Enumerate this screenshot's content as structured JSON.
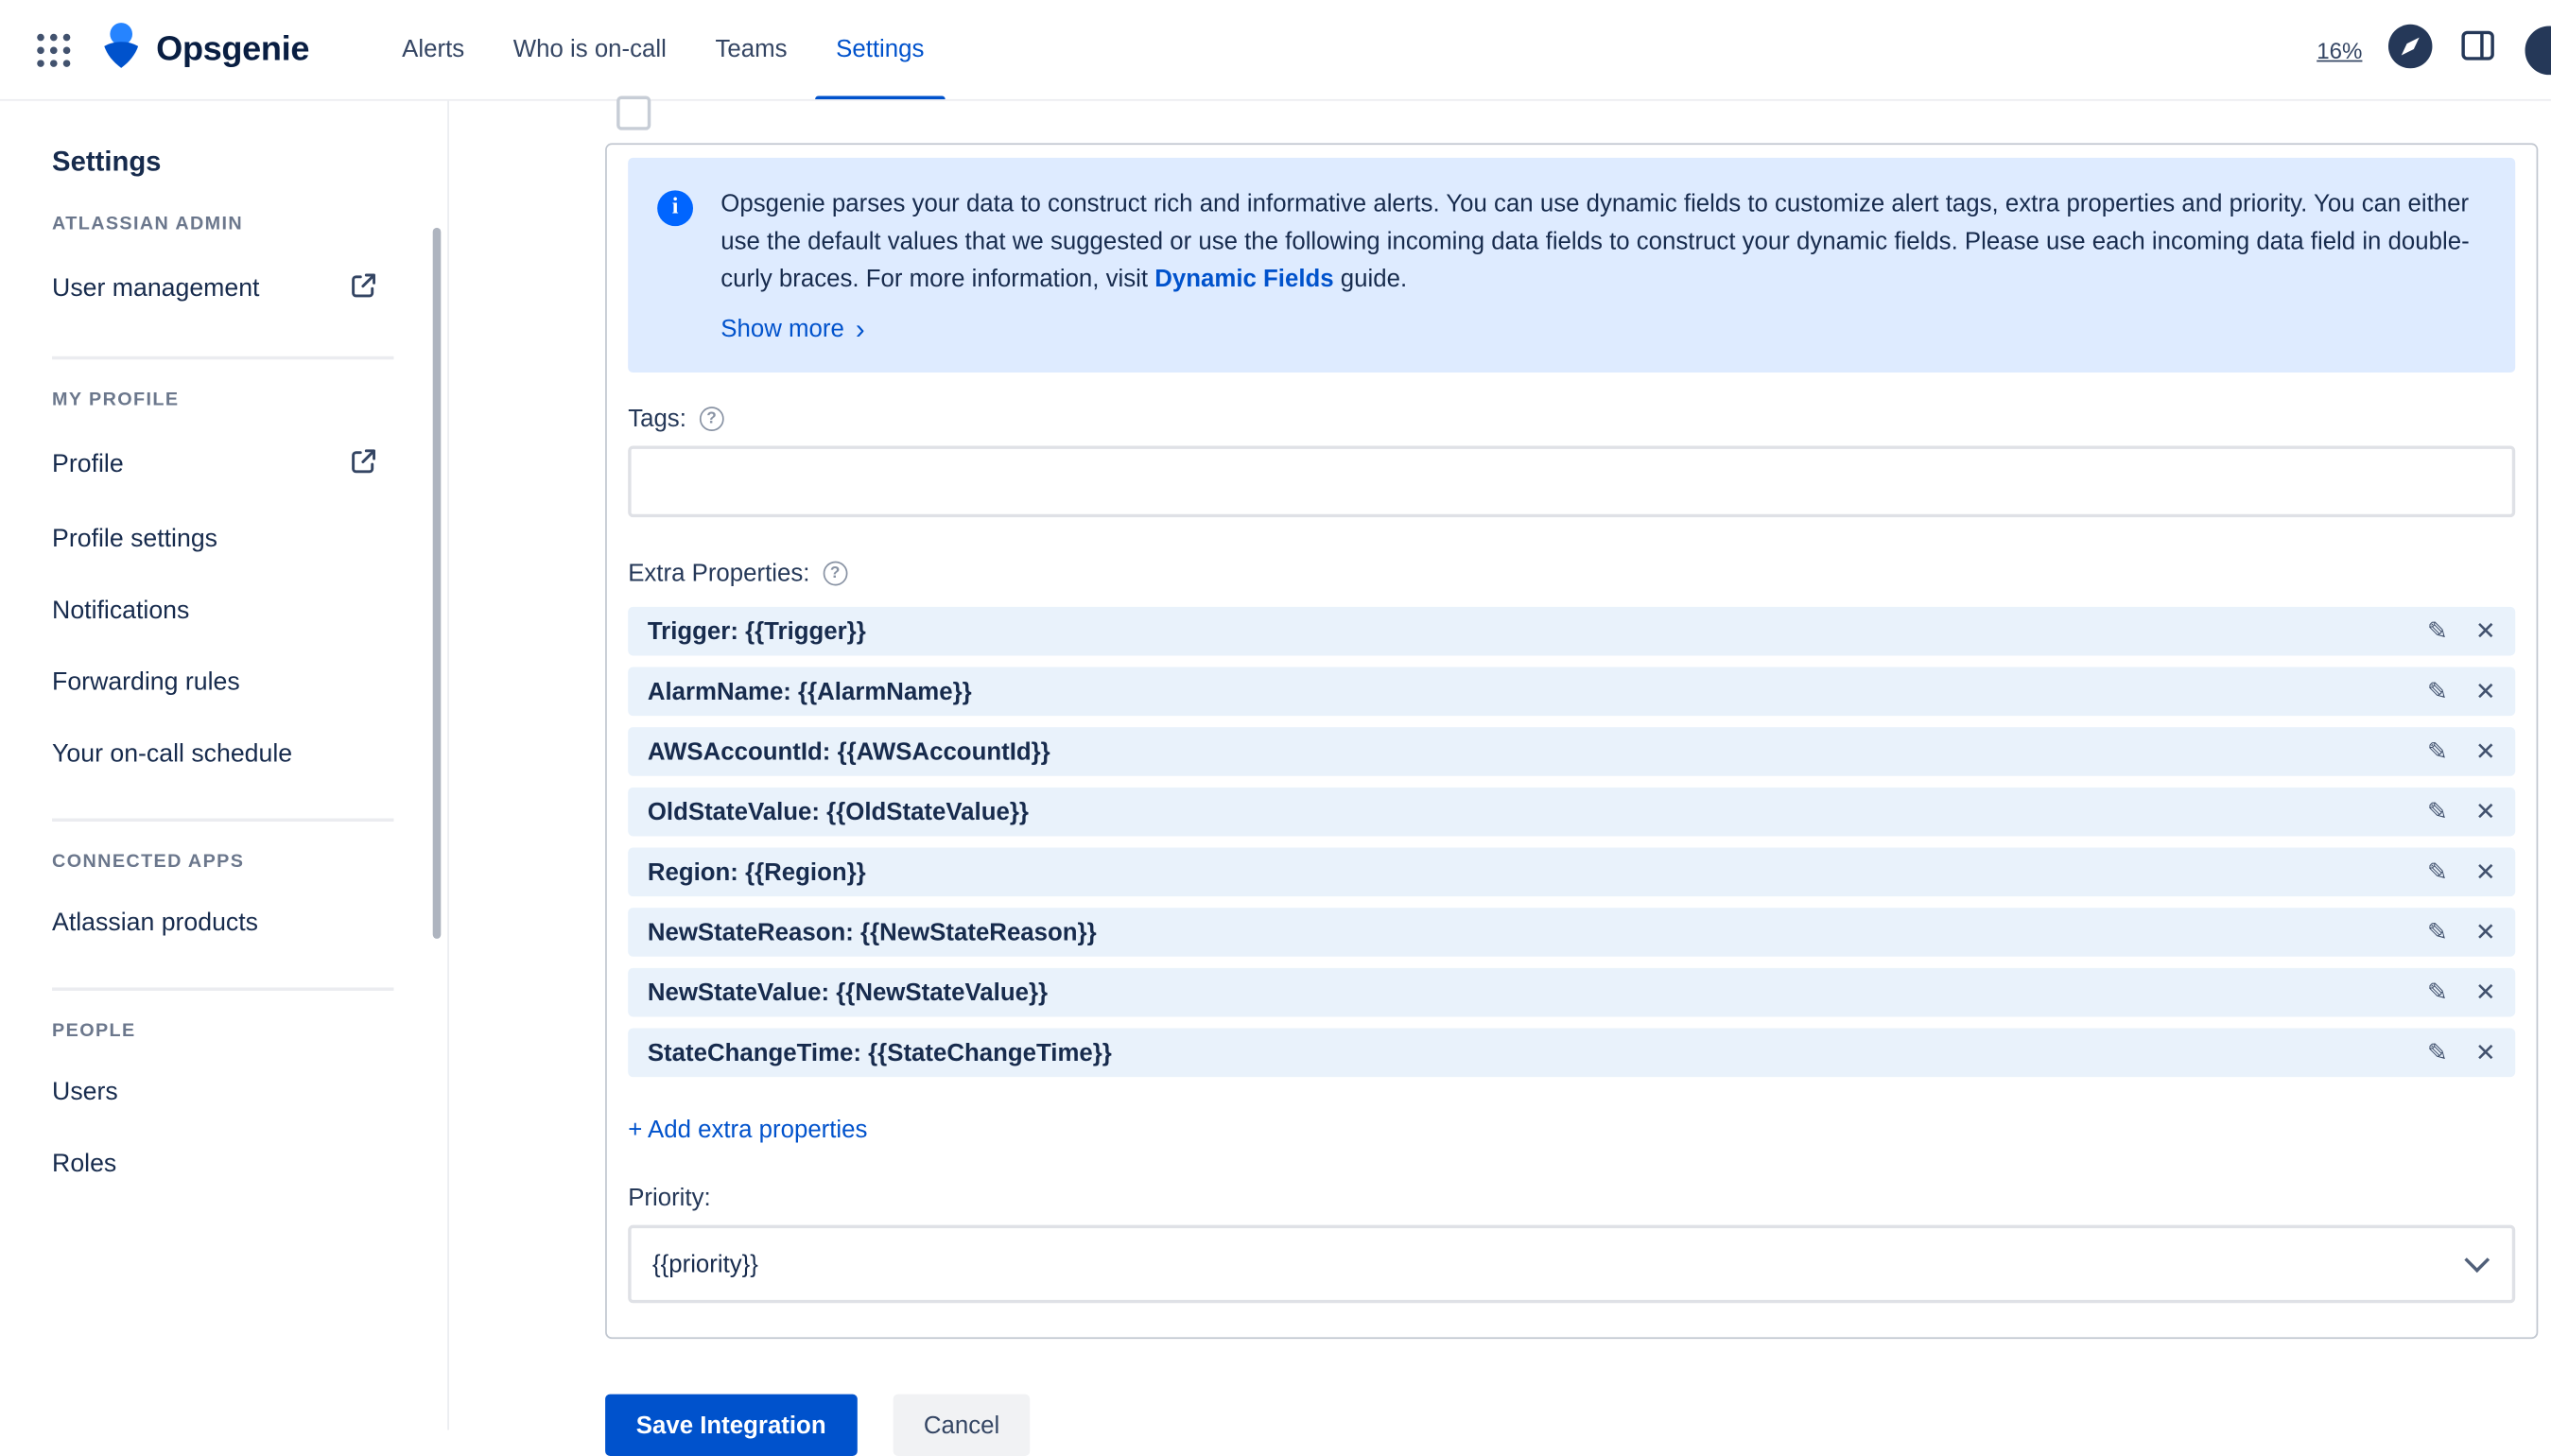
{
  "nav": {
    "brand": "Opsgenie",
    "items": [
      {
        "label": "Alerts",
        "active": false
      },
      {
        "label": "Who is on-call",
        "active": false
      },
      {
        "label": "Teams",
        "active": false
      },
      {
        "label": "Settings",
        "active": true
      }
    ],
    "usage": "16%"
  },
  "sidebar": {
    "title": "Settings",
    "sections": [
      {
        "heading": "ATLASSIAN ADMIN",
        "items": [
          {
            "label": "User management",
            "external": true
          }
        ]
      },
      {
        "heading": "MY PROFILE",
        "items": [
          {
            "label": "Profile",
            "external": true
          },
          {
            "label": "Profile settings",
            "external": false
          },
          {
            "label": "Notifications",
            "external": false
          },
          {
            "label": "Forwarding rules",
            "external": false
          },
          {
            "label": "Your on-call schedule",
            "external": false
          }
        ]
      },
      {
        "heading": "CONNECTED APPS",
        "items": [
          {
            "label": "Atlassian products",
            "external": false
          }
        ]
      },
      {
        "heading": "PEOPLE",
        "items": [
          {
            "label": "Users",
            "external": false
          },
          {
            "label": "Roles",
            "external": false
          }
        ]
      }
    ]
  },
  "main": {
    "info": {
      "text": "Opsgenie parses your data to construct rich and informative alerts. You can use dynamic fields to customize alert tags, extra properties and priority. You can either use the default values that we suggested or use the following incoming data fields to construct your dynamic fields. Please use each incoming data field in double-curly braces. For more information, visit ",
      "link_text": "Dynamic Fields",
      "after_link": " guide.",
      "show_more": "Show more"
    },
    "tags": {
      "label": "Tags:",
      "value": "",
      "placeholder": ""
    },
    "extra_properties": {
      "label": "Extra Properties:",
      "rows": [
        "Trigger: {{Trigger}}",
        "AlarmName: {{AlarmName}}",
        "AWSAccountId: {{AWSAccountId}}",
        "OldStateValue: {{OldStateValue}}",
        "Region: {{Region}}",
        "NewStateReason: {{NewStateReason}}",
        "NewStateValue: {{NewStateValue}}",
        "StateChangeTime: {{StateChangeTime}}"
      ],
      "add_label": "+ Add extra properties"
    },
    "priority": {
      "label": "Priority:",
      "value": "{{priority}}"
    },
    "buttons": {
      "save": "Save Integration",
      "cancel": "Cancel"
    }
  },
  "icons": {
    "edit": "✎",
    "remove": "✕",
    "show_more_chevron": "›",
    "info": "i",
    "help": "?"
  },
  "colors": {
    "accent": "#0052CC",
    "info_background": "#DEEBFF",
    "info_icon": "#0065FF",
    "property_row_background": "#E9F2FB",
    "nav_active": "#0052CC",
    "text_primary": "#172B4D",
    "text_muted": "#6B778C"
  }
}
